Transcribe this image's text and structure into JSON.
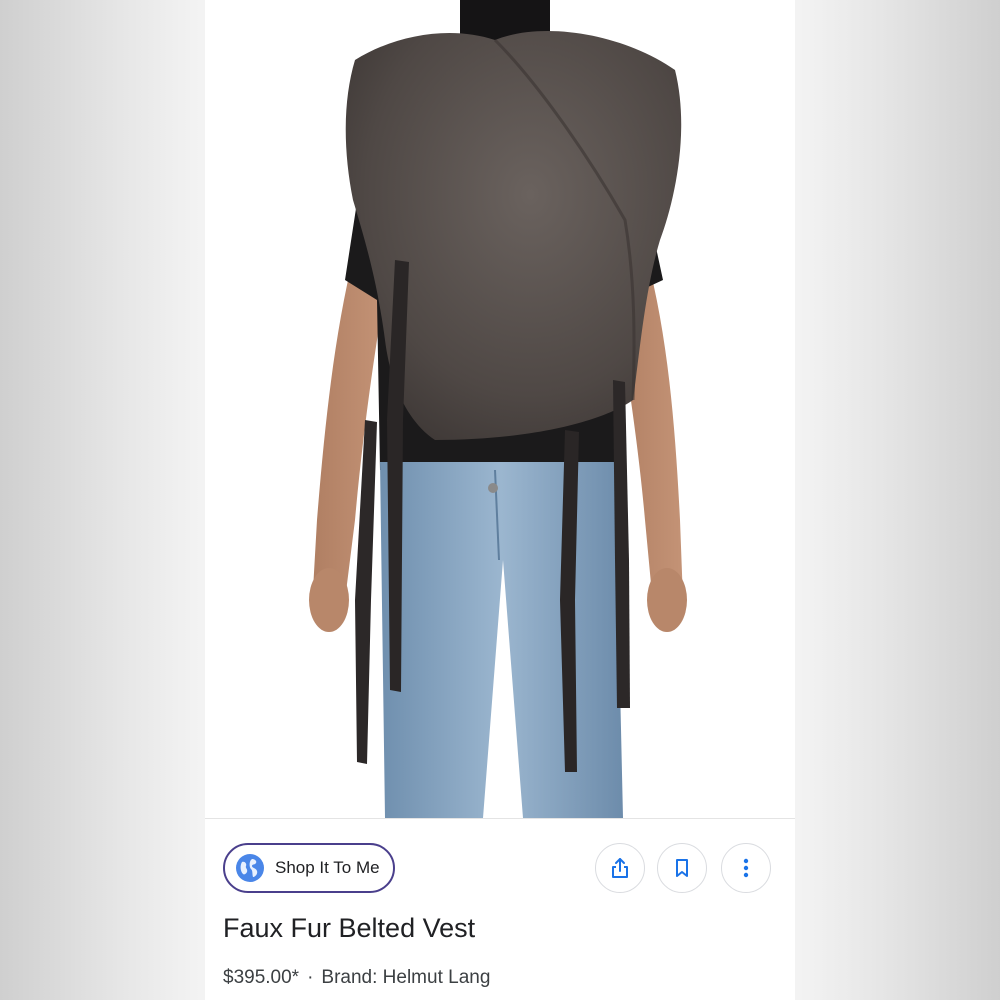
{
  "product": {
    "title": "Faux Fur Belted Vest",
    "price": "$395.00*",
    "separator": "·",
    "brand": "Brand: Helmut Lang"
  },
  "actions": {
    "shop_label": "Shop It To Me",
    "shop_icon": "globe-icon",
    "share_icon": "share-icon",
    "bookmark_icon": "bookmark-icon",
    "more_icon": "more-vertical-icon"
  },
  "colors": {
    "accent": "#1a73e8",
    "shop_border": "#4a3f8c",
    "fur": "#4f4845",
    "denim": "#7f9fbc"
  }
}
